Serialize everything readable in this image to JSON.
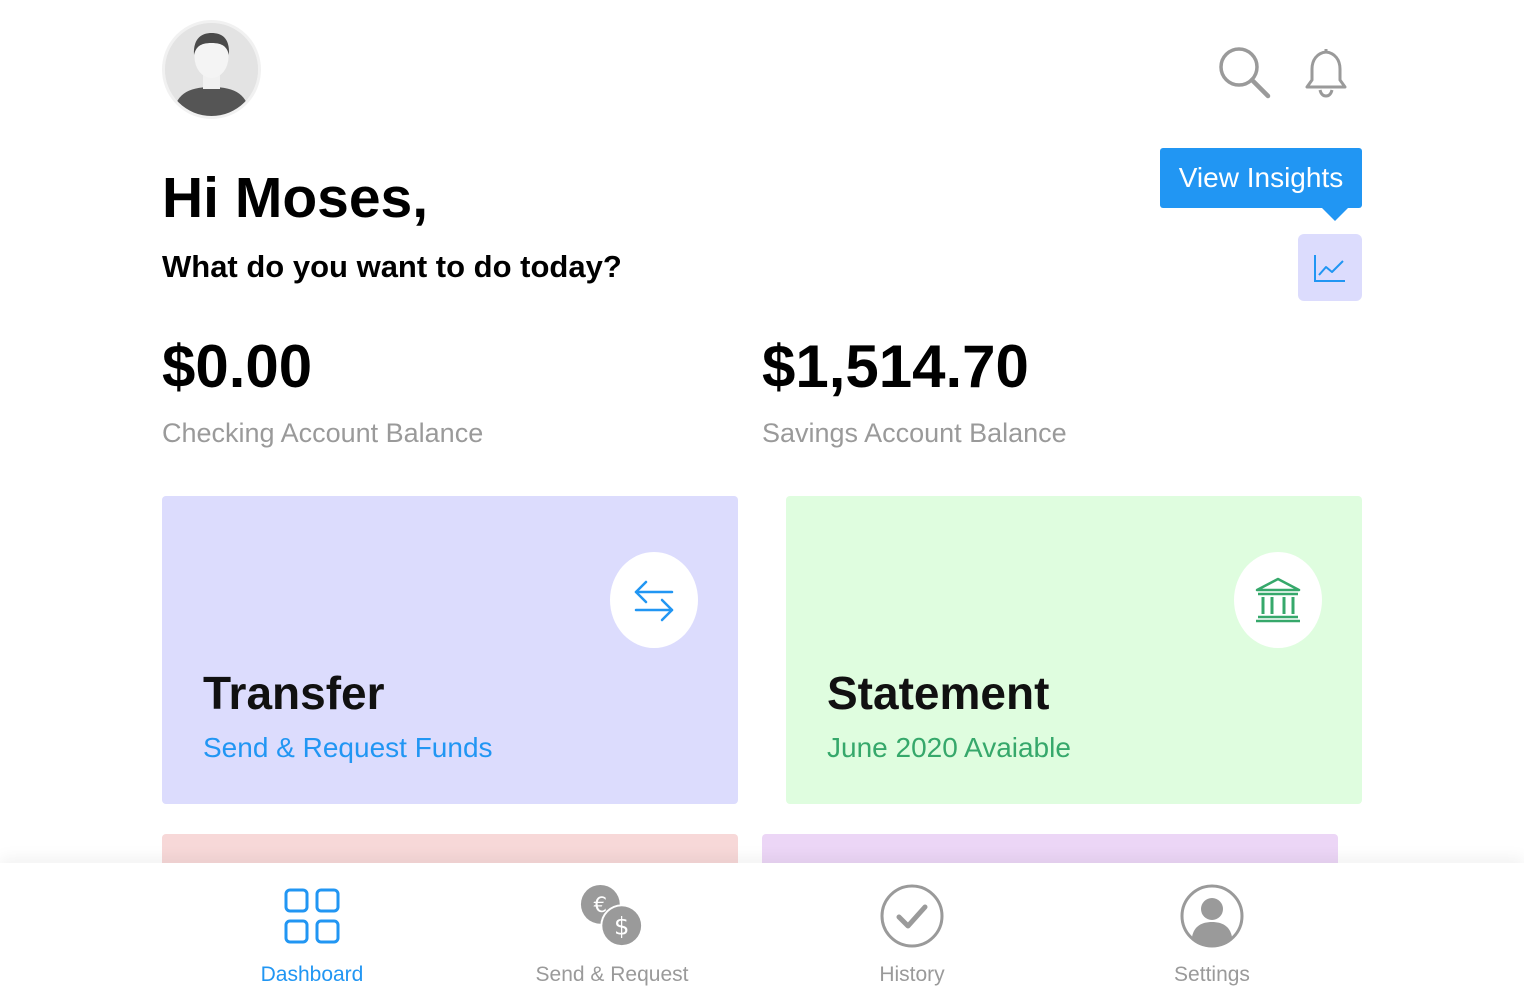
{
  "header": {
    "avatar_icon": "user-avatar-icon",
    "search_icon": "search-icon",
    "bell_icon": "bell-icon"
  },
  "insights": {
    "tooltip_label": "View Insights",
    "button_icon": "line-chart-icon"
  },
  "greeting": {
    "title": "Hi Moses,",
    "subtitle": "What do you want to do today?"
  },
  "balances": [
    {
      "amount": "$0.00",
      "label": "Checking Account Balance"
    },
    {
      "amount": "$1,514.70",
      "label": "Savings Account Balance"
    }
  ],
  "cards": [
    {
      "title": "Transfer",
      "subtitle": "Send & Request Funds",
      "icon": "transfer-arrows-icon",
      "color": "#dcdcfd",
      "accent": "#2196f3"
    },
    {
      "title": "Statement",
      "subtitle": "June 2020 Avaiable",
      "icon": "bank-icon",
      "color": "#dffddf",
      "accent": "#36a86b"
    }
  ],
  "nav": [
    {
      "label": "Dashboard",
      "icon": "grid-icon",
      "active": true
    },
    {
      "label": "Send & Request",
      "icon": "currency-exchange-icon",
      "active": false
    },
    {
      "label": "History",
      "icon": "check-circle-icon",
      "active": false
    },
    {
      "label": "Settings",
      "icon": "user-circle-icon",
      "active": false
    }
  ],
  "colors": {
    "accent": "#2196f3",
    "muted": "#9a9a9a",
    "transfer_bg": "#dcdcfd",
    "statement_bg": "#dffddf",
    "peek_left_bg": "#f7d8d8",
    "peek_right_bg": "#ecd6f6"
  }
}
